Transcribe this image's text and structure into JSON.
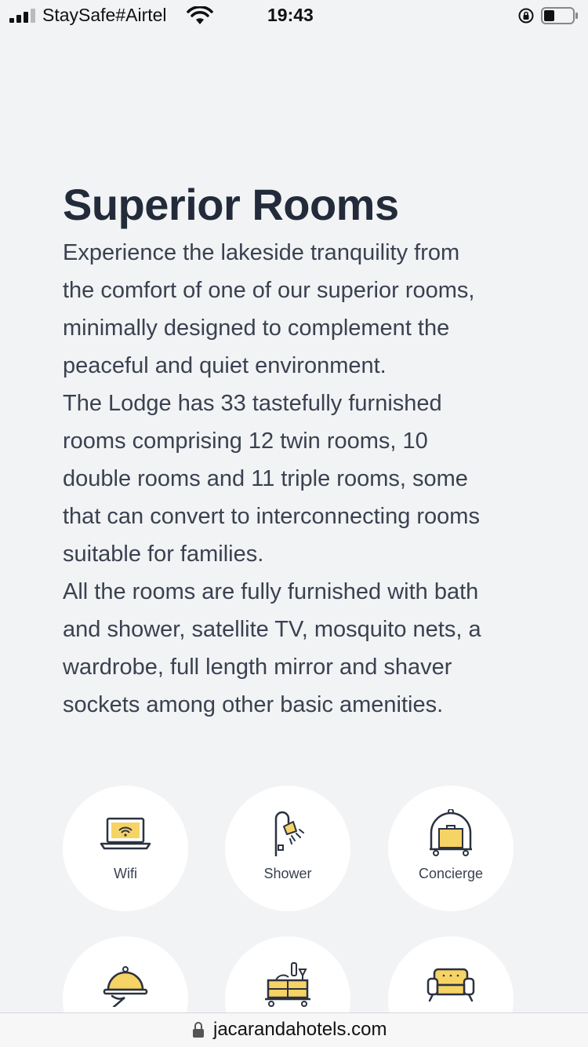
{
  "status_bar": {
    "carrier": "StaySafe#Airtel",
    "time": "19:43"
  },
  "page": {
    "title": "Superior Rooms",
    "paragraphs": [
      "Experience the lakeside tranquility from\nthe comfort of one of our superior rooms,\nminimally designed to complement the\npeaceful and quiet environment.",
      "The Lodge has 33 tastefully furnished\nrooms comprising 12 twin rooms, 10\ndouble rooms and 11 triple rooms, some\nthat can convert to interconnecting rooms\nsuitable for families.",
      "All the rooms are fully furnished with bath\nand shower, satellite TV, mosquito nets, a\nwardrobe, full length mirror and shaver\nsockets among other basic amenities."
    ]
  },
  "amenities": [
    {
      "label": "Wifi",
      "icon": "laptop-wifi-icon"
    },
    {
      "label": "Shower",
      "icon": "shower-icon"
    },
    {
      "label": "Concierge",
      "icon": "luggage-trolley-icon"
    },
    {
      "label": "",
      "icon": "room-service-cloche-icon"
    },
    {
      "label": "",
      "icon": "minibar-cart-icon"
    },
    {
      "label": "",
      "icon": "sofa-icon"
    }
  ],
  "browser": {
    "url": "jacarandahotels.com"
  },
  "colors": {
    "background": "#f2f3f5",
    "text_dark": "#232b3a",
    "accent_yellow": "#f6d365",
    "circle": "#ffffff"
  }
}
